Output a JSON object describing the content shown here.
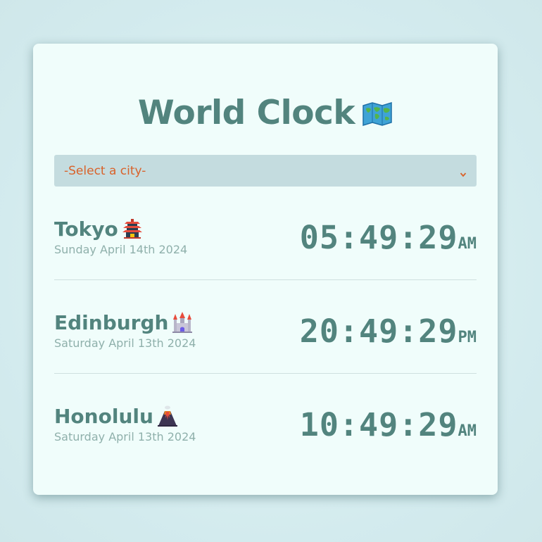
{
  "app": {
    "title": "World Clock",
    "title_icon": "world-map-icon"
  },
  "city_select": {
    "placeholder": "-Select a city-",
    "selected": "-Select a city-"
  },
  "colors": {
    "primary": "#52847e",
    "select_text": "#d9622a",
    "select_bg": "#c4dcdf",
    "date_text": "#8fb0ab",
    "card_bg": "#f0fdfb"
  },
  "cities": [
    {
      "name": "Tokyo",
      "icon": "pagoda-icon",
      "date": "Sunday April 14th 2024",
      "time": "05:49:29",
      "ampm": "AM"
    },
    {
      "name": "Edinburgh",
      "icon": "castle-icon",
      "date": "Saturday April 13th 2024",
      "time": "20:49:29",
      "ampm": "PM"
    },
    {
      "name": "Honolulu",
      "icon": "volcano-icon",
      "date": "Saturday April 13th 2024",
      "time": "10:49:29",
      "ampm": "AM"
    }
  ]
}
